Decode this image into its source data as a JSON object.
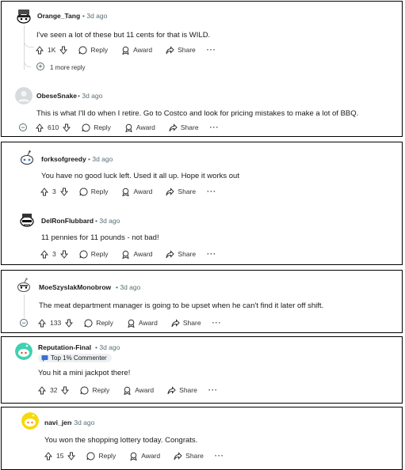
{
  "time_sep": "•",
  "panel1": {
    "c1": {
      "username": "Orange_Tang",
      "time": "3d ago",
      "text": "I've seen a lot of these but 11 cents for that is WILD.",
      "votes": "1K",
      "reply": "Reply",
      "award": "Award",
      "share": "Share",
      "more": "···"
    },
    "more_replies": "1 more reply",
    "c2": {
      "username": "ObeseSnake",
      "time": "3d ago",
      "text": "This is what I'll do when I retire. Go to Costco and look for pricing mistakes to make a lot of BBQ.",
      "votes": "610",
      "reply": "Reply",
      "award": "Award",
      "share": "Share",
      "more": "···"
    }
  },
  "panel2": {
    "c1": {
      "username": "forksofgreedy",
      "time": "3d ago",
      "text": "You have no good luck left. Used it all up. Hope it works out",
      "votes": "3",
      "reply": "Reply",
      "award": "Award",
      "share": "Share",
      "more": "···"
    },
    "c2": {
      "username": "DelRonFlubbard",
      "time": "3d ago",
      "text": "11 pennies for 11 pounds - not bad!",
      "votes": "3",
      "reply": "Reply",
      "award": "Award",
      "share": "Share",
      "more": "···"
    }
  },
  "panel3": {
    "c1": {
      "username": "MoeSzyslakMonobrow",
      "time": "3d ago",
      "text": "The meat department manager is going to be upset when he can't find it later off shift.",
      "votes": "133",
      "reply": "Reply",
      "award": "Award",
      "share": "Share",
      "more": "···"
    }
  },
  "panel4": {
    "c1": {
      "username": "Reputation-Final",
      "time": "3d ago",
      "badge": "Top 1% Commenter",
      "text": "You hit a mini jackpot there!",
      "votes": "32",
      "reply": "Reply",
      "award": "Award",
      "share": "Share",
      "more": "···"
    }
  },
  "panel5": {
    "c1": {
      "username": "navi_jen",
      "time": "3d ago",
      "text": "You won the shopping lottery today. Congrats.",
      "votes": "15",
      "reply": "Reply",
      "award": "Award",
      "share": "Share",
      "more": "···"
    }
  },
  "colors": {
    "meta": "#576f76",
    "thread": "#d5dadc",
    "avatar_teal": "#3fd1b0",
    "avatar_yellow": "#f5d90a"
  }
}
